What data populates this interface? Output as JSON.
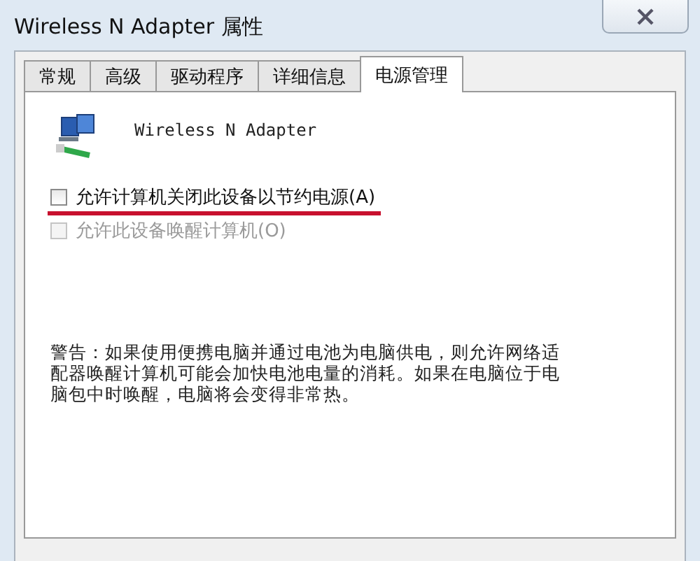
{
  "window": {
    "title": "Wireless N Adapter 属性"
  },
  "tabs": [
    {
      "label": "常规",
      "selected": false
    },
    {
      "label": "高级",
      "selected": false
    },
    {
      "label": "驱动程序",
      "selected": false
    },
    {
      "label": "详细信息",
      "selected": false
    },
    {
      "label": "电源管理",
      "selected": true
    }
  ],
  "device": {
    "name": "Wireless N Adapter"
  },
  "options": [
    {
      "label": "允许计算机关闭此设备以节约电源(A)",
      "checked": false,
      "disabled": false,
      "highlighted": true
    },
    {
      "label": "允许此设备唤醒计算机(O)",
      "checked": false,
      "disabled": true,
      "highlighted": false
    }
  ],
  "warning": "警告：如果使用便携电脑并通过电池为电脑供电，则允许网络适配器唤醒计算机可能会加快电池电量的消耗。如果在电脑位于电脑包中时唤醒，电脑将会变得非常热。"
}
